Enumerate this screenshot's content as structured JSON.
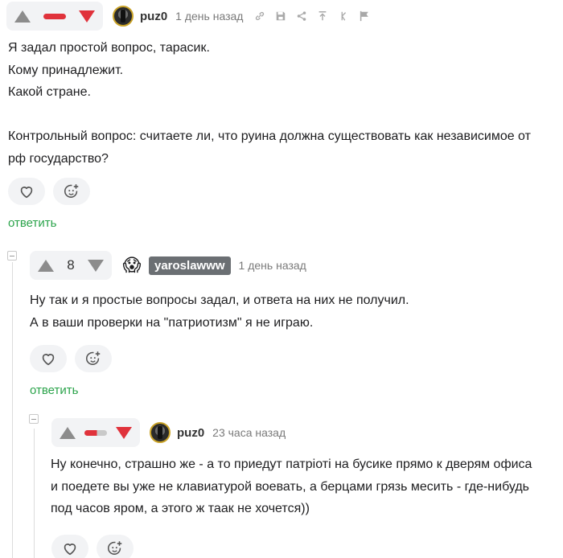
{
  "comments": [
    {
      "user": "puz0",
      "time": "1 день назад",
      "lines": [
        "Я задал простой вопрос, тарасик.",
        "Кому принадлежит.",
        "Какой стране.",
        "",
        "Контрольный вопрос: считаете ли, что руина должна существовать как независимое от",
        "рф государство?"
      ],
      "reply_label": "ответить",
      "rating_display": "bar",
      "vote": "down"
    },
    {
      "user": "yaroslawww",
      "time": "1 день назад",
      "rating": "8",
      "lines": [
        "Ну так и я простые вопросы задал, и ответа на них не получил.",
        "А в ваши проверки на \"патриотизм\" я не играю."
      ],
      "reply_label": "ответить",
      "vote": "none"
    },
    {
      "user": "puz0",
      "time": "23 часа назад",
      "lines": [
        "Ну конечно, страшно же - а то приедут патріоті на бусике прямо к дверям офиса",
        "и поедете вы уже не клавиатурой воевать, а берцами грязь месить - где-нибудь",
        "под часов яром, а этого ж таак не хочется))"
      ],
      "rating_display": "mixed-bar",
      "vote": "down"
    }
  ],
  "icons": {
    "tools": [
      "link-icon",
      "save-icon",
      "share-icon",
      "jump-to-parent-icon",
      "branch-icon",
      "flag-icon"
    ],
    "reactions": [
      "heart-icon",
      "add-reaction-icon"
    ]
  },
  "colors": {
    "accent_green": "#2aa34a",
    "downvote_red": "#e0323b",
    "neutral_grey": "#8c8c8c",
    "pill_bg": "#f2f3f5"
  }
}
